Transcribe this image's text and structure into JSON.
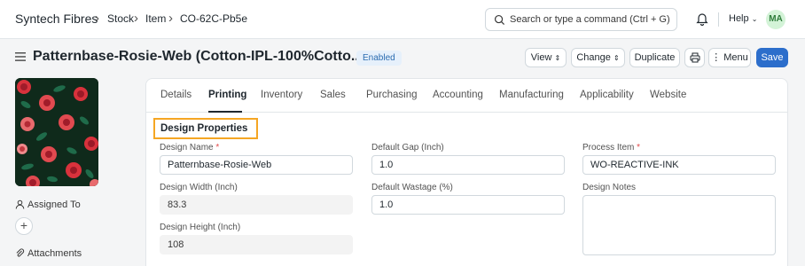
{
  "navbar": {
    "brand": "Syntech Fibres",
    "breadcrumbs": [
      "Stock",
      "Item",
      "CO-62C-Pb5e"
    ],
    "search_placeholder": "Search or type a command (Ctrl + G)",
    "help_label": "Help",
    "avatar_initials": "MA"
  },
  "page": {
    "title": "Patternbase-Rosie-Web (Cotton-IPL-100%Cotto...",
    "status": "Enabled",
    "buttons": {
      "view": "View",
      "change": "Change",
      "duplicate": "Duplicate",
      "menu": "Menu",
      "save": "Save"
    }
  },
  "sidebar": {
    "assigned_to": "Assigned To",
    "attachments": "Attachments"
  },
  "tabs": [
    "Details",
    "Printing",
    "Inventory",
    "Sales",
    "Purchasing",
    "Accounting",
    "Manufacturing",
    "Applicability",
    "Website"
  ],
  "active_tab": "Printing",
  "form": {
    "section_title": "Design Properties",
    "design_name": {
      "label": "Design Name",
      "value": "Patternbase-Rosie-Web"
    },
    "design_width": {
      "label": "Design Width (Inch)",
      "value": "83.3"
    },
    "design_height": {
      "label": "Design Height (Inch)",
      "value": "108"
    },
    "default_gap": {
      "label": "Default Gap (Inch)",
      "value": "1.0"
    },
    "default_wastage": {
      "label": "Default Wastage (%)",
      "value": "1.0"
    },
    "process_item": {
      "label": "Process Item",
      "value": "WO-REACTIVE-INK"
    },
    "design_notes": {
      "label": "Design Notes",
      "value": ""
    }
  },
  "colors": {
    "primary": "#2c6ecb",
    "highlight": "#f5a623",
    "required": "#e24c4c",
    "badge_bg": "#e6f0fb"
  }
}
